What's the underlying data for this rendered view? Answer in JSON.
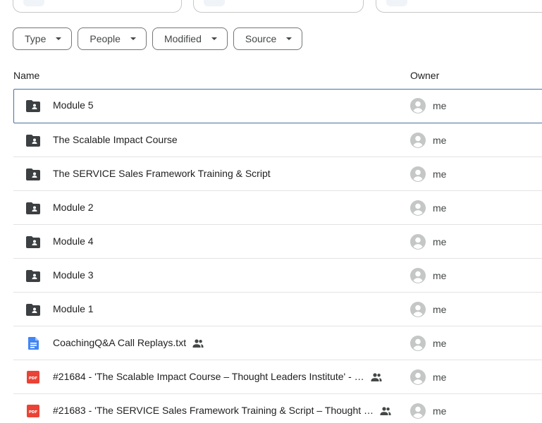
{
  "filters": [
    {
      "label": "Type"
    },
    {
      "label": "People"
    },
    {
      "label": "Modified"
    },
    {
      "label": "Source"
    }
  ],
  "columns": {
    "name": "Name",
    "owner": "Owner"
  },
  "rows": [
    {
      "name": "Module 5",
      "type": "folder-shared",
      "owner": "me",
      "shared": false,
      "selected": true
    },
    {
      "name": "The Scalable Impact Course",
      "type": "folder-shared",
      "owner": "me",
      "shared": false,
      "selected": false
    },
    {
      "name": "The SERVICE Sales Framework Training & Script",
      "type": "folder-shared",
      "owner": "me",
      "shared": false,
      "selected": false
    },
    {
      "name": "Module 2",
      "type": "folder-shared",
      "owner": "me",
      "shared": false,
      "selected": false
    },
    {
      "name": "Module 4",
      "type": "folder-shared",
      "owner": "me",
      "shared": false,
      "selected": false
    },
    {
      "name": "Module 3",
      "type": "folder-shared",
      "owner": "me",
      "shared": false,
      "selected": false
    },
    {
      "name": "Module 1",
      "type": "folder-shared",
      "owner": "me",
      "shared": false,
      "selected": false
    },
    {
      "name": "CoachingQ&A Call Replays.txt",
      "type": "doc",
      "owner": "me",
      "shared": true,
      "selected": false
    },
    {
      "name": "#21684 - 'The Scalable Impact Course – Thought Leaders Institute' - …",
      "type": "pdf",
      "owner": "me",
      "shared": true,
      "selected": false
    },
    {
      "name": "#21683 - 'The SERVICE Sales Framework Training & Script – Thought …",
      "type": "pdf",
      "owner": "me",
      "shared": true,
      "selected": false
    }
  ],
  "icons": {
    "folder": "folder-shared-icon",
    "doc": "google-docs-icon",
    "pdf": "pdf-icon",
    "shared": "people-icon",
    "avatar": "account-circle-icon",
    "caret": "caret-down-icon"
  },
  "colors": {
    "folder": "#3c4043",
    "doc": "#4285f4",
    "pdf": "#ea4335",
    "selected_border": "#4a6fa5",
    "avatar": "#c4c7c5"
  }
}
